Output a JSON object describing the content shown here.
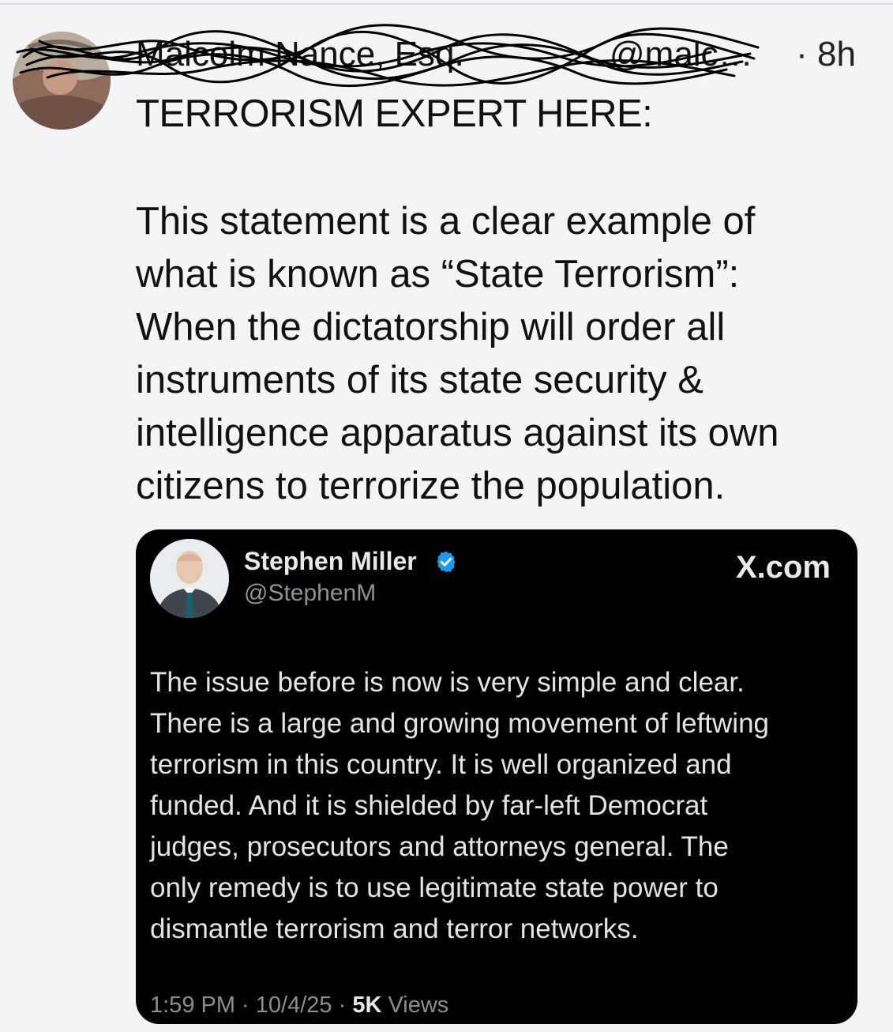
{
  "post": {
    "author_name": "Malcolm Nance, Esq.",
    "author_handle": "@malc…",
    "time_meta": "· 8h",
    "heading": "TERRORISM EXPERT HERE:",
    "body_lines": [
      "This statement is a clear example of",
      "what is known as “State Terrorism”:",
      "When the dictatorship will order all",
      "instruments of its state security &",
      "intelligence apparatus against its own",
      "citizens to terrorize the population."
    ]
  },
  "embedded_tweet": {
    "name": "Stephen Miller",
    "handle": "@StephenM",
    "source_logo": "X.com",
    "body_lines": [
      "The issue before is now is very simple and clear.",
      "There is a large and growing movement of leftwing",
      "terrorism in this country. It is well organized and",
      "funded. And it is shielded by far-left Democrat",
      "judges, prosecutors and attorneys general. The",
      "only remedy is to use legitimate state power to",
      "dismantle terrorism and terror networks."
    ],
    "time": "1:59 PM",
    "date": "10/4/25",
    "views_count": "5K",
    "views_label": "Views",
    "separator": " · "
  },
  "icons": {
    "verified": "verified-badge-icon",
    "author_verified": "verified-badge-icon"
  },
  "colors": {
    "page_bg": "#f4f4f6",
    "card_bg": "#000000",
    "verified_blue": "#1d9bf0",
    "muted_text": "#8b8f93"
  }
}
